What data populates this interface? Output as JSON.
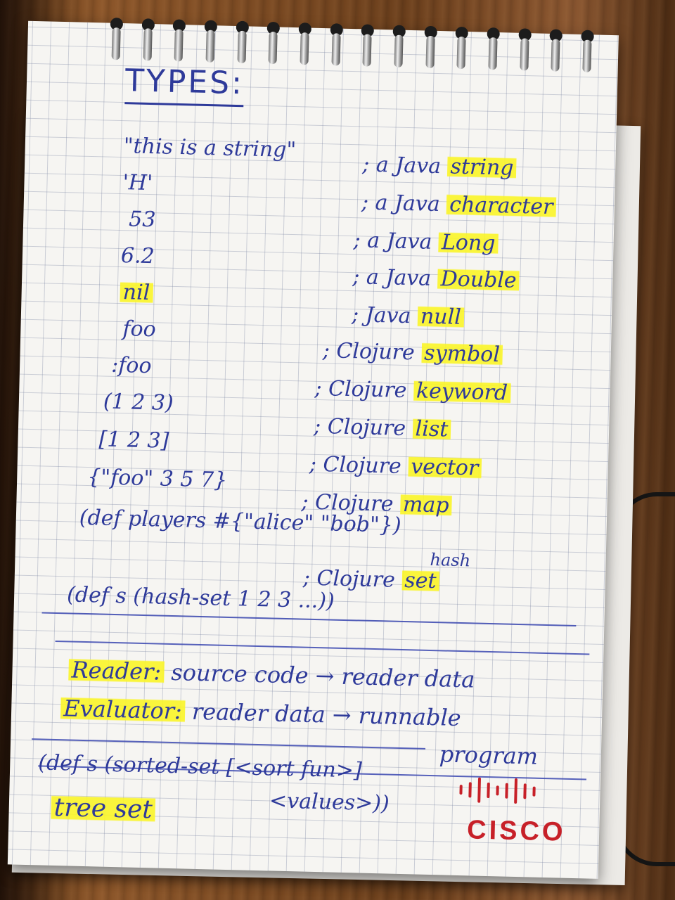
{
  "notebook": {
    "title": "TYPES:",
    "rows": [
      {
        "code": "\"this is a string\"",
        "comment_prefix": "; a Java",
        "highlight": "string"
      },
      {
        "code": "'H'",
        "comment_prefix": "; a Java",
        "highlight": "character"
      },
      {
        "code": "53",
        "comment_prefix": "; a Java",
        "highlight": "Long"
      },
      {
        "code": "6.2",
        "comment_prefix": "; a Java",
        "highlight": "Double"
      },
      {
        "code": "nil",
        "comment_prefix": "; Java",
        "highlight": "null"
      },
      {
        "code": "foo",
        "comment_prefix": "; Clojure",
        "highlight": "symbol"
      },
      {
        "code": ":foo",
        "comment_prefix": "; Clojure",
        "highlight": "keyword"
      },
      {
        "code": "(1 2 3)",
        "comment_prefix": "; Clojure",
        "highlight": "list"
      },
      {
        "code": "[1 2 3]",
        "comment_prefix": "; Clojure",
        "highlight": "vector"
      },
      {
        "code": "{\"foo\" 3 5 7}",
        "comment_prefix": "; Clojure",
        "highlight": "map"
      }
    ],
    "set_line": "(def players #{\"alice\" \"bob\"})",
    "set_note_hash": "hash",
    "set_comment_prefix": "; Clojure",
    "set_comment_highlight": "set",
    "hashset_line": "(def s (hash-set 1 2 3 ...))",
    "reader_label": "Reader:",
    "reader_text": "source code → reader data",
    "evaluator_label": "Evaluator:",
    "evaluator_text": "reader data → runnable",
    "evaluator_text2": "program",
    "sorted_line": "(def s (sorted-set [<sort fun>]",
    "sorted_line2": "<values>))",
    "tree_set": "tree set",
    "brand": "CISCO",
    "colors": {
      "ink": "#2e3a9a",
      "highlight": "#faf528",
      "brand": "#c72028"
    }
  }
}
